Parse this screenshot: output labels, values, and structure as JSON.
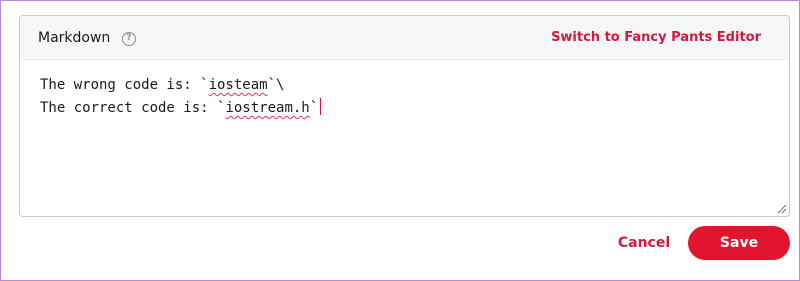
{
  "editor": {
    "mode_label": "Markdown",
    "help_icon": "question-circle-icon",
    "switch_link": "Switch to Fancy Pants Editor",
    "lines": [
      {
        "prefix": "The wrong code is: `",
        "word": "iosteam",
        "suffix": "`\\"
      },
      {
        "prefix": "The correct code is: `",
        "word": "iostream.h",
        "suffix": "`"
      }
    ],
    "resize_icon": "resize-grip-icon"
  },
  "actions": {
    "cancel_label": "Cancel",
    "save_label": "Save"
  },
  "colors": {
    "accent": "#d41a3c",
    "save_bg": "#e2152f",
    "frame_border": "#b889d6"
  }
}
